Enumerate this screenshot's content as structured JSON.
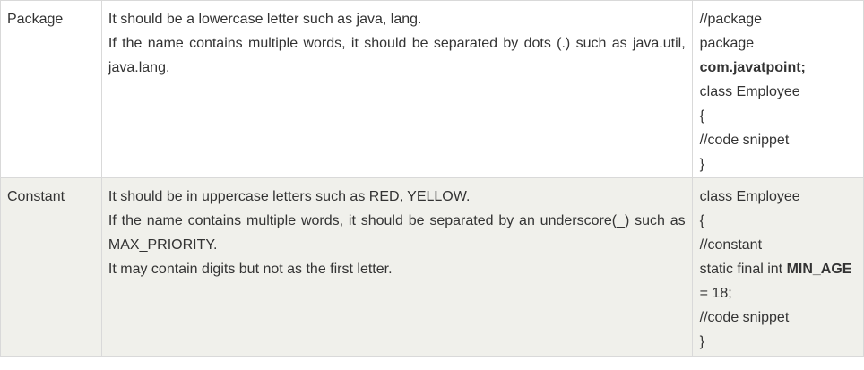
{
  "rows": [
    {
      "name": "Package",
      "description": [
        "It should be a lowercase letter such as java, lang.",
        "If the name contains multiple words, it should be separated by dots (.) such as java.util, java.lang."
      ],
      "example": {
        "line1": "//package",
        "line2": "package",
        "line3_bold": "com.javatpoint;",
        "line4": "class Employee",
        "line5": "{",
        "line6": "//code snippet",
        "line7": "}"
      }
    },
    {
      "name": "Constant",
      "description": [
        "It should be in uppercase letters such as RED, YELLOW.",
        "If the name contains multiple words, it should be separated by an underscore(_) such as MAX_PRIORITY.",
        "It may contain digits but not as the first letter."
      ],
      "example": {
        "line1": "class Employee",
        "line2": "{",
        "line3": "//constant",
        "line4_prefix": "static final int ",
        "line4_bold": "MIN_AGE",
        "line5": "= 18;",
        "line6": "//code snippet",
        "line7": "}"
      }
    }
  ]
}
